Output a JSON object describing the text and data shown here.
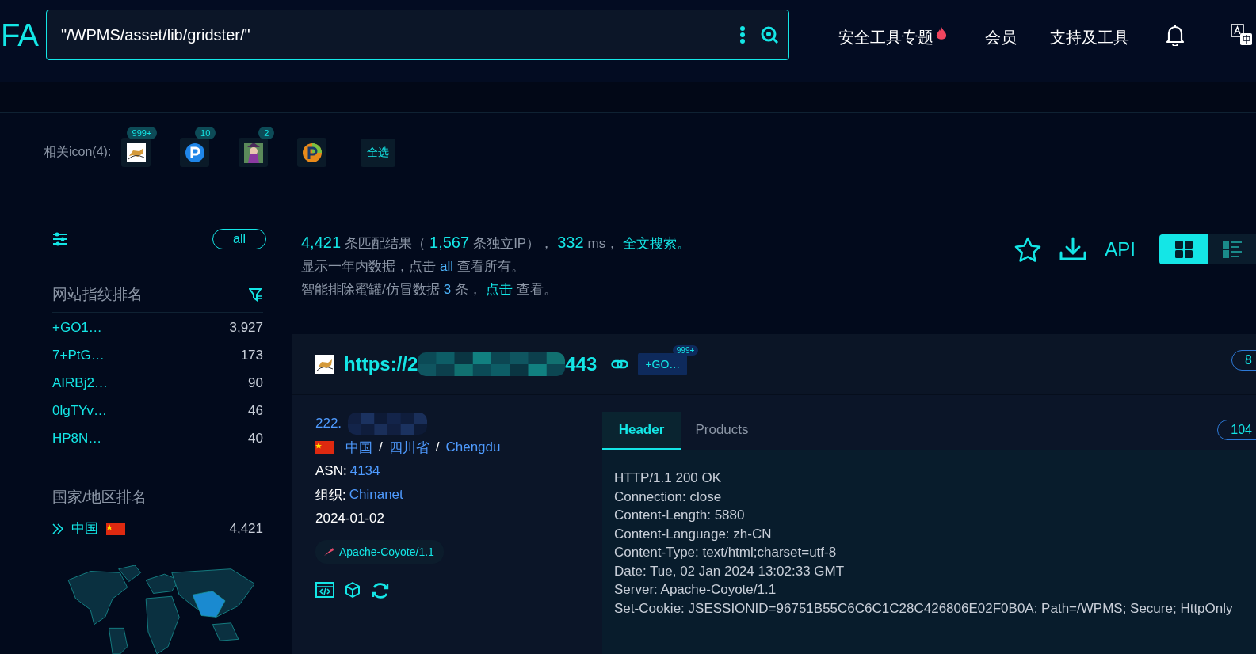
{
  "header": {
    "logo": "FA",
    "search": {
      "value": "\"/WPMS/asset/lib/gridster/\""
    },
    "nav": [
      {
        "label": "安全工具专题",
        "hot": true
      },
      {
        "label": "会员",
        "hot": false
      },
      {
        "label": "支持及工具",
        "hot": false
      }
    ]
  },
  "related_icons": {
    "label": "相关icon(4):",
    "icons": [
      {
        "kind": "cat",
        "count": "999+"
      },
      {
        "kind": "p-blue",
        "count": "10"
      },
      {
        "kind": "figure",
        "count": "2"
      },
      {
        "kind": "p-color"
      }
    ],
    "select_all": "全选"
  },
  "sidebar": {
    "all_button": "all",
    "fingerprint_heading": "网站指纹排名",
    "fingerprints": [
      {
        "name": "+GO1…",
        "count": "3,927"
      },
      {
        "name": "7+PtG…",
        "count": "173"
      },
      {
        "name": "AIRBj2…",
        "count": "90"
      },
      {
        "name": "0lgTYv…",
        "count": "46"
      },
      {
        "name": "HP8N…",
        "count": "40"
      }
    ],
    "country_heading": "国家/地区排名",
    "countries": [
      {
        "name": "中国",
        "count": "4,421"
      }
    ]
  },
  "stats": {
    "lines": [
      [
        {
          "kind": "number",
          "text": "4,421"
        },
        {
          "kind": "text",
          "text": "条匹配结果（"
        },
        {
          "kind": "number",
          "text": "1,567"
        },
        {
          "kind": "text",
          "text": "条独立IP），"
        },
        {
          "kind": "number",
          "text": "332"
        },
        {
          "kind": "text",
          "text": "ms，"
        },
        {
          "kind": "link",
          "text": "全文搜索。"
        }
      ],
      [
        {
          "kind": "text",
          "text": "显示一年内数据，点击"
        },
        {
          "kind": "number",
          "text": "all"
        },
        {
          "kind": "text",
          "text": "查看所有。"
        }
      ],
      [
        {
          "kind": "text",
          "text": "智能排除蜜罐/仿冒数据"
        },
        {
          "kind": "number",
          "text": "3"
        },
        {
          "kind": "text",
          "text": "条，"
        },
        {
          "kind": "link",
          "text": "点击"
        },
        {
          "kind": "text",
          "text": "查看。"
        }
      ]
    ]
  },
  "actions": {
    "api": "API",
    "views": [
      {
        "kind": "grid",
        "selected": true
      },
      {
        "kind": "list",
        "selected": false
      }
    ]
  },
  "result": {
    "url_start": "https://2",
    "url_end": "443",
    "tag": {
      "label": "+GO…",
      "count": "999+"
    },
    "side_pill": "8",
    "ip": "222.",
    "location": [
      {
        "kind": "link",
        "text": "中国"
      },
      {
        "kind": "sep",
        "text": "/"
      },
      {
        "kind": "link",
        "text": "四川省"
      },
      {
        "kind": "sep",
        "text": "/"
      },
      {
        "kind": "link",
        "text": "Chengdu"
      }
    ],
    "asn_label": "ASN:",
    "asn": "4134",
    "org_label": "组织:",
    "org": "Chinanet",
    "date": "2024-01-02",
    "server_tag": "Apache-Coyote/1.1",
    "tabs": [
      {
        "label": "Header",
        "selected": true
      },
      {
        "label": "Products",
        "selected": false
      }
    ],
    "size_pill": "104",
    "header_lines": [
      "HTTP/1.1 200 OK",
      "Connection: close",
      "Content-Length: 5880",
      "Content-Language: zh-CN",
      "Content-Type: text/html;charset=utf-8",
      "Date: Tue, 02 Jan 2024 13:02:33 GMT",
      "Server: Apache-Coyote/1.1",
      "Set-Cookie: JSESSIONID=96751B55C6C6C1C28C426806E02F0B0A; Path=/WPMS; Secure; HttpOnly"
    ]
  }
}
